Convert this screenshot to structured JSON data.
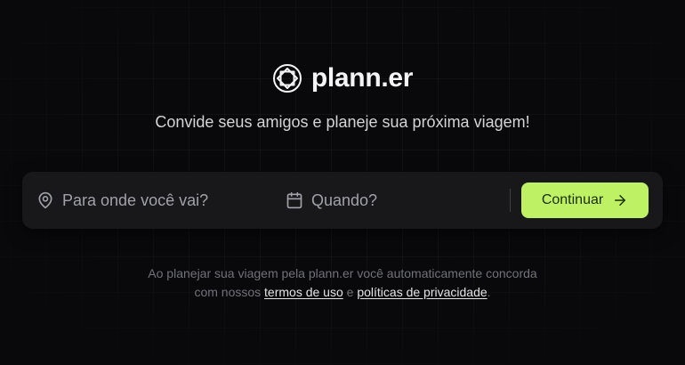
{
  "brand": {
    "name": "plann.er",
    "logo_icon": "compass-globe-icon"
  },
  "subtitle": "Convide seus amigos e planeje sua próxima viagem!",
  "search": {
    "destination_placeholder": "Para onde você vai?",
    "destination_value": "",
    "destination_icon": "map-pin-icon",
    "date_placeholder": "Quando?",
    "date_value": "",
    "date_icon": "calendar-icon",
    "continue_label": "Continuar",
    "continue_icon": "arrow-right-icon"
  },
  "terms": {
    "line1": "Ao planejar sua viagem pela plann.er você automaticamente concorda",
    "line2_prefix": "com nossos",
    "terms_link": "termos de uso",
    "conjunction": "e",
    "privacy_link": "políticas de privacidade",
    "suffix": "."
  },
  "colors": {
    "background": "#09090b",
    "panel": "#18181b",
    "accent": "#bef264",
    "accent_text": "#1a2e05",
    "muted_text": "#71717a"
  }
}
